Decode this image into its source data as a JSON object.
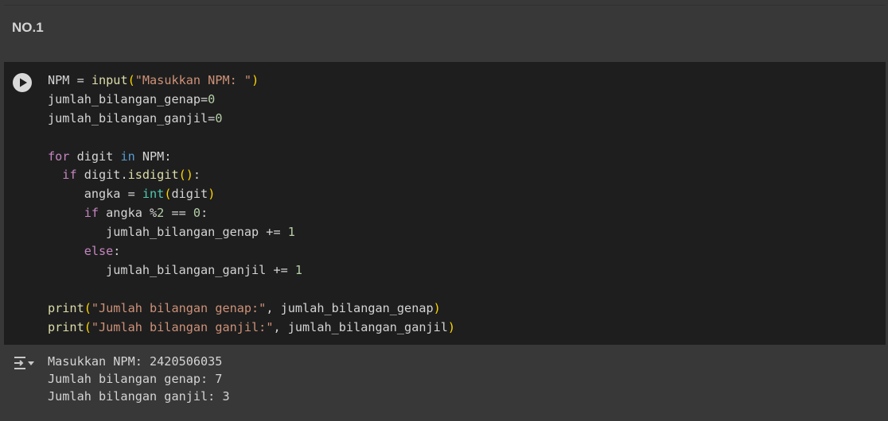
{
  "text_cell": {
    "heading": "NO.1"
  },
  "code_cell": {
    "run_icon": "play-circle-icon",
    "tokens": {
      "l1": {
        "a": "NPM = ",
        "b": "input",
        "c": "(",
        "d": "\"Masukkan NPM: \"",
        "e": ")"
      },
      "l2": {
        "a": "jumlah_bilangan_genap=",
        "b": "0"
      },
      "l3": {
        "a": "jumlah_bilangan_ganjil=",
        "b": "0"
      },
      "l5": {
        "a": "for",
        "b": " digit ",
        "c": "in",
        "d": " NPM:"
      },
      "l6": {
        "a": "  ",
        "b": "if",
        "c": " digit.",
        "d": "isdigit",
        "e": "()",
        "f": ":"
      },
      "l7": {
        "a": "     angka = ",
        "b": "int",
        "c": "(",
        "d": "digit",
        "e": ")"
      },
      "l8": {
        "a": "     ",
        "b": "if",
        "c": " angka %",
        "d": "2",
        "e": " == ",
        "f": "0",
        "g": ":"
      },
      "l9": {
        "a": "        jumlah_bilangan_genap += ",
        "b": "1"
      },
      "l10": {
        "a": "     ",
        "b": "else",
        "c": ":"
      },
      "l11": {
        "a": "        jumlah_bilangan_ganjil += ",
        "b": "1"
      },
      "l13": {
        "a": "print",
        "b": "(",
        "c": "\"Jumlah bilangan genap:\"",
        "d": ", jumlah_bilangan_genap",
        "e": ")"
      },
      "l14": {
        "a": "print",
        "b": "(",
        "c": "\"Jumlah bilangan ganjil:\"",
        "d": ", jumlah_bilangan_ganjil",
        "e": ")"
      }
    }
  },
  "output": {
    "icon": "output-toggle-icon",
    "lines": [
      "Masukkan NPM: 2420506035",
      "Jumlah bilangan genap: 7",
      "Jumlah bilangan ganjil: 3"
    ]
  },
  "colors": {
    "background": "#383838",
    "code_background": "#1e1e1e",
    "keyword": "#c586c0",
    "function": "#dcdcaa",
    "string": "#ce9178",
    "number": "#b5cea8",
    "bracket": "#ffd700"
  }
}
